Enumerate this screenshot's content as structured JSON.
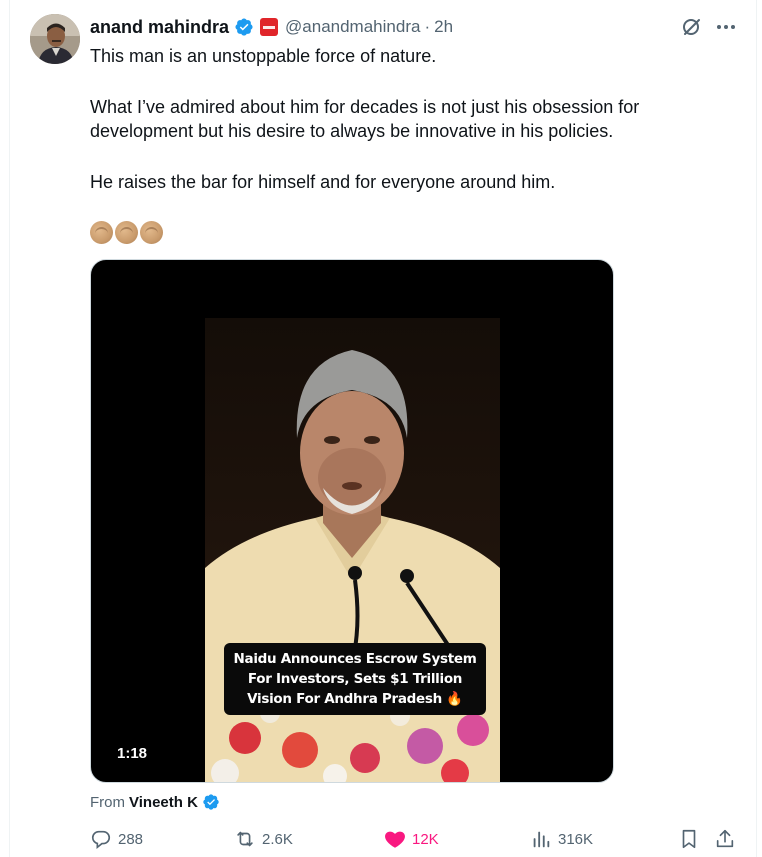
{
  "tweet": {
    "author_name": "anand mahindra",
    "handle": "@anandmahindra",
    "separator": "·",
    "time": "2h",
    "text_line1": "This man is an unstoppable force of nature.",
    "text_line2": "What I’ve admired about him for decades is not just his obsession for development but his desire to always be innovative in his policies.",
    "text_line3": "He raises the bar for himself and for everyone around him.",
    "emoji": [
      "clapping-hands",
      "clapping-hands",
      "clapping-hands"
    ]
  },
  "media": {
    "caption": "Naidu Announces Escrow System For Investors, Sets $1 Trillion Vision For Andhra Pradesh 🔥",
    "duration": "1:18"
  },
  "from": {
    "label": "From",
    "name": "Vineeth K"
  },
  "actions": {
    "replies": "288",
    "reposts": "2.6K",
    "likes": "12K",
    "views": "316K"
  },
  "colors": {
    "verified": "#1d9bf0",
    "like": "#f91880",
    "affiliate": "#e0252a",
    "muted": "#536471"
  },
  "icons": [
    "grok-icon",
    "more-icon",
    "verified-badge-icon",
    "affiliate-badge-icon",
    "reply-icon",
    "repost-icon",
    "like-icon",
    "views-icon",
    "bookmark-icon",
    "share-icon"
  ]
}
